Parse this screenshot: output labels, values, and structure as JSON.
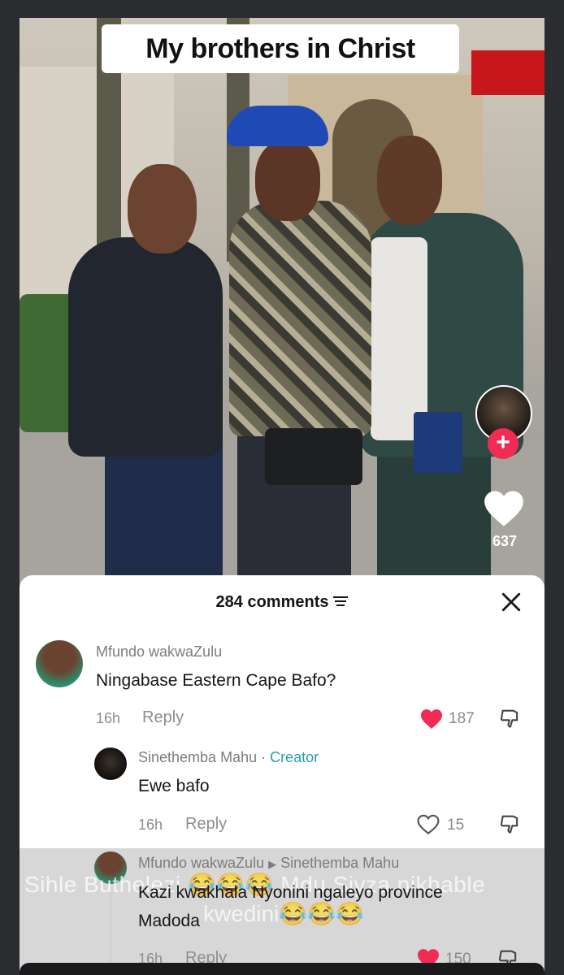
{
  "video": {
    "caption": "My brothers in Christ",
    "likes": "637"
  },
  "comments_panel": {
    "title": "284 comments",
    "comments": [
      {
        "username": "Mfundo wakwaZulu",
        "text": "Ningabase Eastern Cape Bafo?",
        "time": "16h",
        "reply_label": "Reply",
        "likes": "187",
        "liked": true
      },
      {
        "username": "Sinethemba Mahu",
        "badge_sep": " · ",
        "badge": "Creator",
        "text": "Ewe bafo",
        "time": "16h",
        "reply_label": "Reply",
        "likes": "15",
        "liked": false
      },
      {
        "username": "Mfundo wakwaZulu",
        "reply_to": "Sinethemba Mahu",
        "text_line1": "Kazi kwakhala Nyonini ngaleyo province",
        "text_line2": "Madoda",
        "time": "16h",
        "reply_label": "Reply",
        "likes": "150",
        "liked": true
      }
    ]
  },
  "overlay_text": {
    "line1": "Sihle Buthelezi 😂😂😂 Mdu Siyza nikhable",
    "line2": "kwedini😂😂😂"
  },
  "colors": {
    "like_red": "#f02b54",
    "creator_teal": "#20a0b0"
  }
}
